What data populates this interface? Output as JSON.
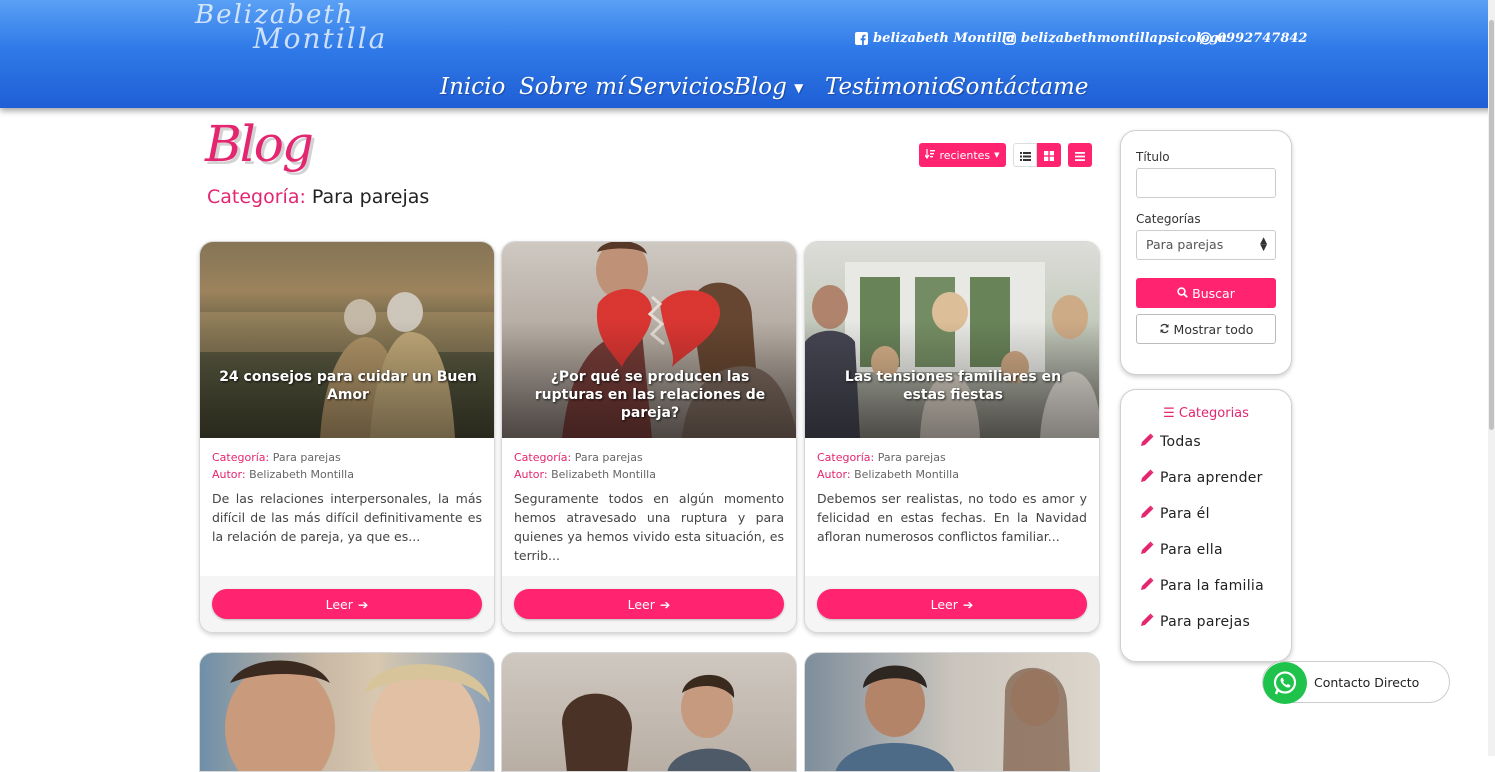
{
  "header": {
    "logo_line1": "Belizabeth",
    "logo_line2": "Montilla",
    "social": {
      "facebook": "belizabeth Montilla",
      "instagram": "belizabethmontillapsicologa",
      "whatsapp": "0992747842"
    },
    "nav": {
      "inicio": "Inicio",
      "sobre": "Sobre mí",
      "servicios": "Servicios",
      "blog": "Blog",
      "testimonios": "Testimonios",
      "contacto": "Contáctame"
    }
  },
  "page": {
    "title": "Blog",
    "category_label": "Categoría:",
    "category_value": "Para parejas",
    "sort_label": "recientes"
  },
  "posts": [
    {
      "title": "24 consejos para cuidar un Buen Amor",
      "category_key": "Categoría:",
      "category": "Para parejas",
      "author_key": "Autor:",
      "author": "Belizabeth Montilla",
      "excerpt": "De las relaciones interpersonales, la más difícil de las más difícil definitivamente es la relación de pareja, ya que es...",
      "button": "Leer"
    },
    {
      "title": "¿Por qué se producen las rupturas en las relaciones de pareja?",
      "category_key": "Categoría:",
      "category": "Para parejas",
      "author_key": "Autor:",
      "author": "Belizabeth Montilla",
      "excerpt": "Seguramente todos en algún momento hemos atravesado una ruptura y para quienes ya hemos vivido esta situación, es terrib...",
      "button": "Leer"
    },
    {
      "title": "Las tensiones familiares en estas fiestas",
      "category_key": "Categoría:",
      "category": "Para parejas",
      "author_key": "Autor:",
      "author": "Belizabeth Montilla",
      "excerpt": "Debemos ser realistas, no todo es amor y felicidad en estas fechas.  En la Navidad afloran numerosos conflictos familiar...",
      "button": "Leer"
    }
  ],
  "sidebar": {
    "title_label": "Título",
    "title_value": "",
    "categories_label": "Categorías",
    "categories_selected": "Para parejas",
    "search_button": "Buscar",
    "show_all_button": "Mostrar todo",
    "categories_heading": "Categorias",
    "categories": [
      "Todas",
      "Para aprender",
      "Para él",
      "Para ella",
      "Para la familia",
      "Para parejas"
    ]
  },
  "whatsapp_widget": {
    "label": "Contacto Directo"
  },
  "colors": {
    "accent": "#ff2370",
    "header_blue": "#2f7ae8",
    "whatsapp_green": "#1fc24a"
  }
}
